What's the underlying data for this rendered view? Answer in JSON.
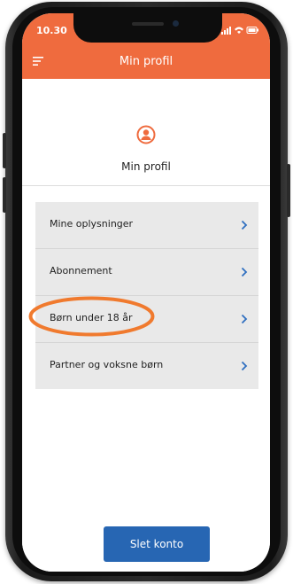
{
  "status_bar": {
    "time": "10.30"
  },
  "header": {
    "title": "Min profil",
    "menu_icon": "hamburger-menu-icon"
  },
  "profile": {
    "icon": "user-profile-icon",
    "label": "Min profil"
  },
  "menu": {
    "items": [
      {
        "label": "Mine oplysninger",
        "icon": "chevron-right-icon"
      },
      {
        "label": "Abonnement",
        "icon": "chevron-right-icon"
      },
      {
        "label": "Børn under 18 år",
        "icon": "chevron-right-icon",
        "highlighted": true
      },
      {
        "label": "Partner og voksne børn",
        "icon": "chevron-right-icon"
      }
    ]
  },
  "footer": {
    "delete_label": "Slet konto"
  },
  "colors": {
    "brand_orange": "#ef6b3e",
    "button_blue": "#2766b3",
    "chevron_blue": "#2f6fc0",
    "menu_bg": "#e9e9e9",
    "highlight_orange": "#f07a2e"
  }
}
